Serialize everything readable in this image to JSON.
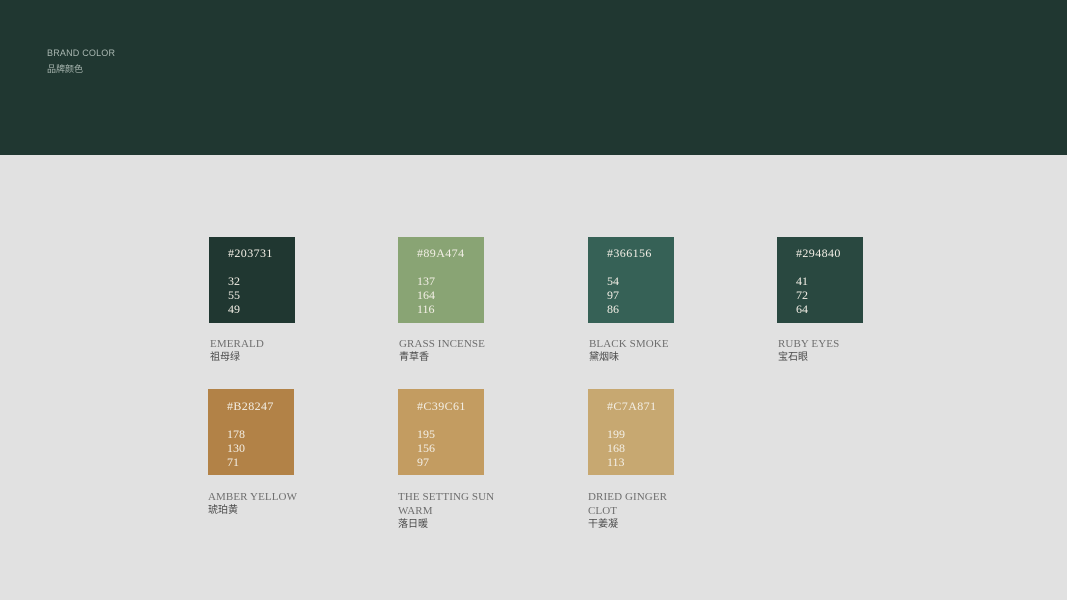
{
  "header": {
    "title": "BRAND COLOR",
    "subtitle": "品牌颜色",
    "background": "#203731"
  },
  "colors": [
    {
      "hex": "#203731",
      "rgb": [
        "32",
        "55",
        "49"
      ],
      "name_en": "EMERALD",
      "name_cn": "祖母绿",
      "fill": "#203731"
    },
    {
      "hex": "#89A474",
      "rgb": [
        "137",
        "164",
        "116"
      ],
      "name_en": "GRASS INCENSE",
      "name_cn": "青草香",
      "fill": "#89A474"
    },
    {
      "hex": "#366156",
      "rgb": [
        "54",
        "97",
        "86"
      ],
      "name_en": "BLACK SMOKE",
      "name_cn": "黛烟味",
      "fill": "#366156"
    },
    {
      "hex": "#294840",
      "rgb": [
        "41",
        "72",
        "64"
      ],
      "name_en": "RUBY EYES",
      "name_cn": "宝石眼",
      "fill": "#294840"
    },
    {
      "hex": "#B28247",
      "rgb": [
        "178",
        "130",
        "71"
      ],
      "name_en": "AMBER YELLOW",
      "name_cn": "琥珀黄",
      "fill": "#B28247"
    },
    {
      "hex": "#C39C61",
      "rgb": [
        "195",
        "156",
        "97"
      ],
      "name_en": "THE SETTING SUN WARM",
      "name_cn": "落日暖",
      "fill": "#C39C61"
    },
    {
      "hex": "#C7A871",
      "rgb": [
        "199",
        "168",
        "113"
      ],
      "name_en": "DRIED GINGER CLOT",
      "name_cn": "干姜凝",
      "fill": "#C7A871"
    }
  ]
}
